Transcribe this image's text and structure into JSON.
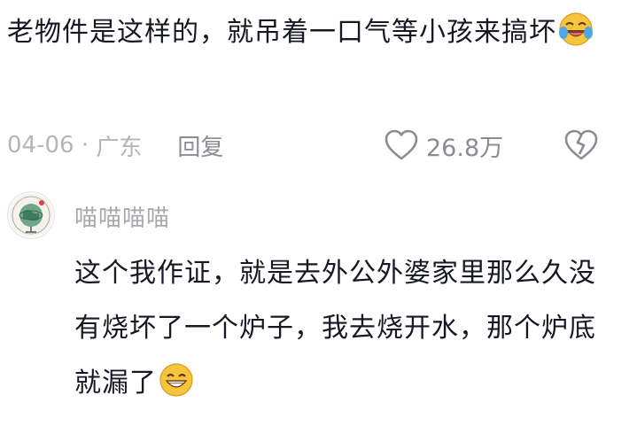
{
  "comment": {
    "text": "老物件是这样的，就吊着一口气等小孩来搞坏",
    "emoji": "laughing-crying-emoji"
  },
  "meta": {
    "date": "04-06",
    "separator": " · ",
    "location": "广东",
    "reply_label": "回复",
    "like_count": "26.8万",
    "like_icon": "heart-outline-icon",
    "dislike_icon": "broken-heart-icon"
  },
  "reply": {
    "username": "喵喵喵喵",
    "text": "这个我作证，就是去外公外婆家里那么久没有烧坏了一个炉子，我去烧开水，那个炉底就漏了",
    "emoji": "grinning-emoji",
    "avatar": "globe-avatar"
  },
  "colors": {
    "text": "#161823",
    "meta": "#a7a9ad",
    "emoji_face": "#f7c53c"
  }
}
